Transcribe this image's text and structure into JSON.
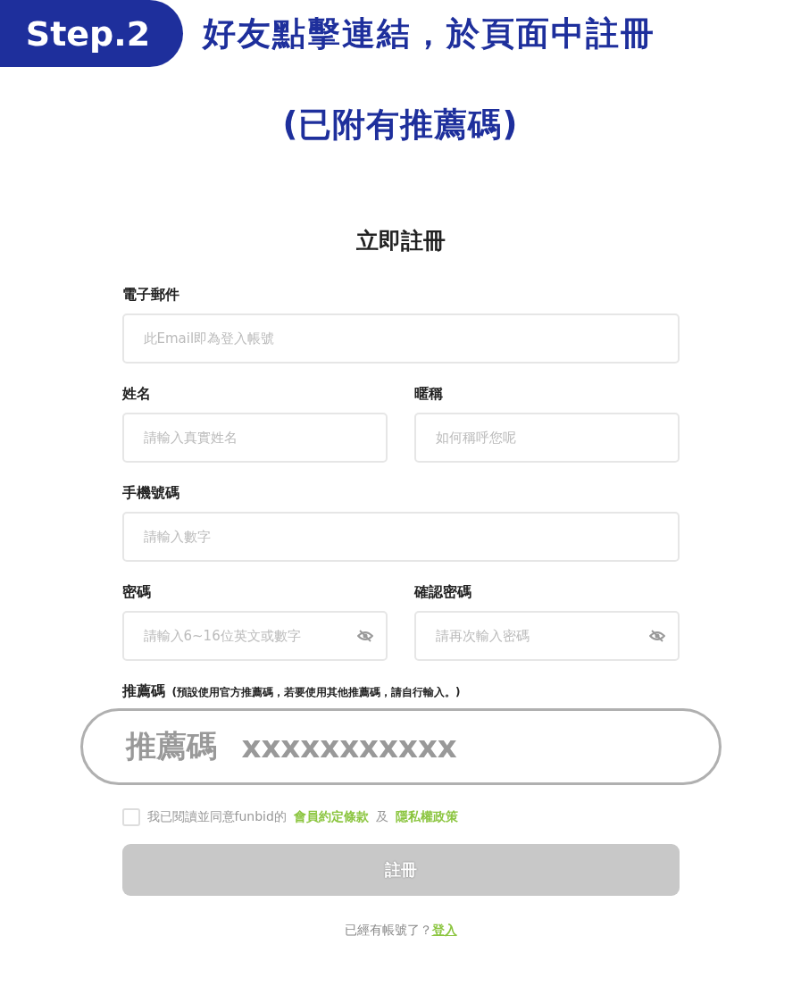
{
  "step": {
    "badge": "Step.2",
    "title": "好友點擊連結，於頁面中註冊",
    "subtitle": "(已附有推薦碼)"
  },
  "form": {
    "title": "立即註冊",
    "rows": [
      [
        {
          "label": "電子郵件",
          "placeholder": "此Email即為登入帳號",
          "kind": "text"
        }
      ],
      [
        {
          "label": "姓名",
          "placeholder": "請輸入真實姓名",
          "kind": "text"
        },
        {
          "label": "暱稱",
          "placeholder": "如何稱呼您呢",
          "kind": "text"
        }
      ],
      [
        {
          "label": "手機號碼",
          "placeholder": "請輸入數字",
          "kind": "text"
        }
      ],
      [
        {
          "label": "密碼",
          "placeholder": "請輸入6~16位英文或數字",
          "kind": "password"
        },
        {
          "label": "確認密碼",
          "placeholder": "請再次輸入密碼",
          "kind": "password"
        }
      ]
    ],
    "referral": {
      "label": "推薦碼",
      "note": "(預設使用官方推薦碼，若要使用其他推薦碼，請自行輸入。)",
      "prefix": "推薦碼",
      "value": "xxxxxxxxxxx"
    },
    "agreement": {
      "checked": false,
      "text": "我已閱讀並同意funbid的",
      "terms_link": "會員約定條款",
      "and": "及",
      "privacy_link": "隱私權政策"
    },
    "submit": {
      "label": "註冊",
      "disabled": true
    },
    "footer": {
      "text": "已經有帳號了？",
      "login_link": "登入"
    }
  }
}
